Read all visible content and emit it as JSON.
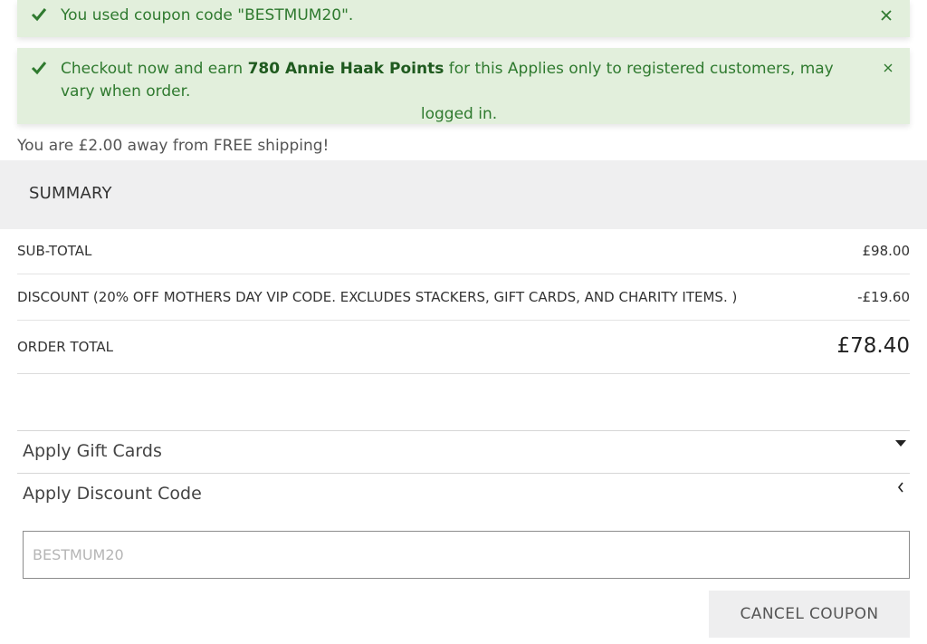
{
  "messages": {
    "coupon_used": "You used coupon code \"BESTMUM20\".",
    "points_prefix": "Checkout now and earn",
    "points_strong": "780 Annie Haak Points",
    "points_suffix": "for this Applies only to registered customers, may vary when order.",
    "points_line2": "logged in."
  },
  "shipping_notice": "You are £2.00 away from FREE shipping!",
  "summary": {
    "title": "SUMMARY",
    "subtotal_label": "SUB-TOTAL",
    "subtotal_value": "£98.00",
    "discount_label": "DISCOUNT (20% OFF MOTHERS DAY VIP CODE. EXCLUDES STACKERS, GIFT CARDS, AND CHARITY ITEMS. )",
    "discount_value": "-£19.60",
    "total_label": "ORDER TOTAL",
    "total_value": "£78.40"
  },
  "accordions": {
    "gift_cards": "Apply Gift Cards",
    "discount_code": "Apply Discount Code"
  },
  "coupon": {
    "placeholder": "BESTMUM20",
    "cancel_label": "CANCEL COUPON"
  },
  "icons": {
    "check": "check-icon",
    "close": "close-icon",
    "caret_down": "caret-down-icon",
    "chevron_left": "chevron-left-icon"
  },
  "colors": {
    "success_bg": "#e2efdc",
    "success_text": "#2f7a2f",
    "summary_bg": "#efeff0"
  }
}
